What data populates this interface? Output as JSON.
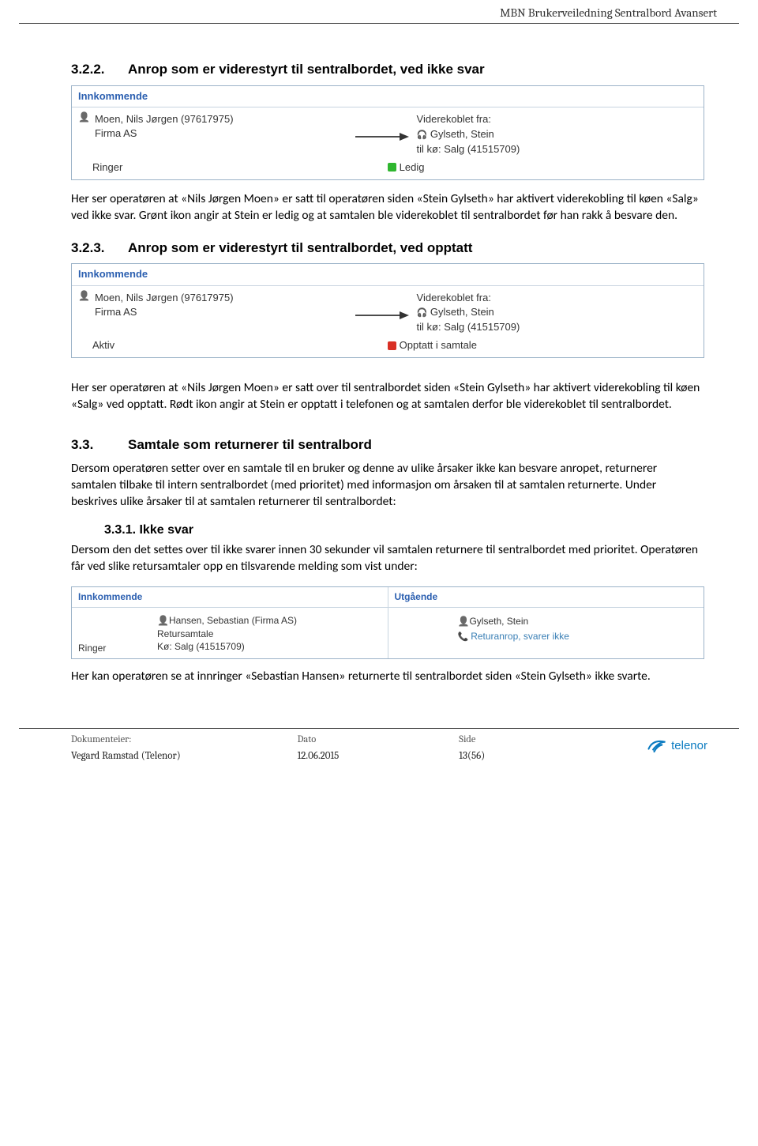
{
  "header": {
    "title": "MBN Brukerveiledning Sentralbord Avansert"
  },
  "s322": {
    "num": "3.2.2.",
    "title": "Anrop som er viderestyrt til sentralbordet, ved ikke svar"
  },
  "box1": {
    "header": "Innkommende",
    "caller_name": "Moen, Nils Jørgen (97617975)",
    "caller_org": "Firma AS",
    "fwd_label": "Viderekoblet fra:",
    "fwd_name": "Gylseth, Stein",
    "fwd_queue": "til kø: Salg (41515709)",
    "left_status": "Ringer",
    "right_status": "Ledig"
  },
  "p1": "Her ser operatøren at «Nils Jørgen Moen» er satt til operatøren siden «Stein Gylseth» har aktivert viderekobling til køen «Salg» ved ikke svar. Grønt ikon angir at Stein er ledig og at samtalen ble viderekoblet til sentralbordet før han rakk å besvare den.",
  "s323": {
    "num": "3.2.3.",
    "title": "Anrop som er viderestyrt til sentralbordet, ved opptatt"
  },
  "box2": {
    "header": "Innkommende",
    "caller_name": "Moen, Nils Jørgen (97617975)",
    "caller_org": "Firma AS",
    "fwd_label": "Viderekoblet fra:",
    "fwd_name": "Gylseth, Stein",
    "fwd_queue": "til kø: Salg (41515709)",
    "left_status": "Aktiv",
    "right_status": "Opptatt i samtale"
  },
  "p2": "Her ser operatøren at «Nils Jørgen Moen» er satt over til sentralbordet siden «Stein Gylseth» har aktivert viderekobling til køen «Salg» ved opptatt. Rødt ikon angir at Stein er opptatt i telefonen og at samtalen derfor ble viderekoblet til sentralbordet.",
  "s33": {
    "num": "3.3.",
    "title": "Samtale som returnerer til sentralbord"
  },
  "p3": "Dersom operatøren setter over en samtale til en bruker og denne av ulike årsaker ikke kan besvare anropet, returnerer samtalen tilbake til intern sentralbordet (med prioritet) med informasjon om årsaken til at samtalen returnerte. Under beskrives ulike årsaker til at samtalen returnerer til sentralbordet:",
  "s331": {
    "num": "3.3.1.",
    "title": "Ikke svar"
  },
  "p4": "Dersom den det settes over til ikke svarer innen 30 sekunder vil samtalen returnere til sentralbordet med prioritet. Operatøren får ved slike retursamtaler opp en tilsvarende melding som vist under:",
  "box3": {
    "in_header": "Innkommende",
    "out_header": "Utgående",
    "in_name": "Hansen, Sebastian (Firma AS)",
    "in_l2": "Retursamtale",
    "in_l3": "Kø: Salg (41515709)",
    "in_status": "Ringer",
    "out_name": "Gylseth, Stein",
    "out_status": "Returanrop, svarer ikke"
  },
  "p5": "Her kan operatøren se at innringer «Sebastian Hansen» returnerte til sentralbordet siden «Stein Gylseth» ikke svarte.",
  "footer": {
    "owner_label": "Dokumenteier:",
    "owner_value": "Vegard Ramstad (Telenor)",
    "date_label": "Dato",
    "date_value": "12.06.2015",
    "page_label": "Side",
    "page_value": "13(56)",
    "logo_text": "telenor"
  }
}
